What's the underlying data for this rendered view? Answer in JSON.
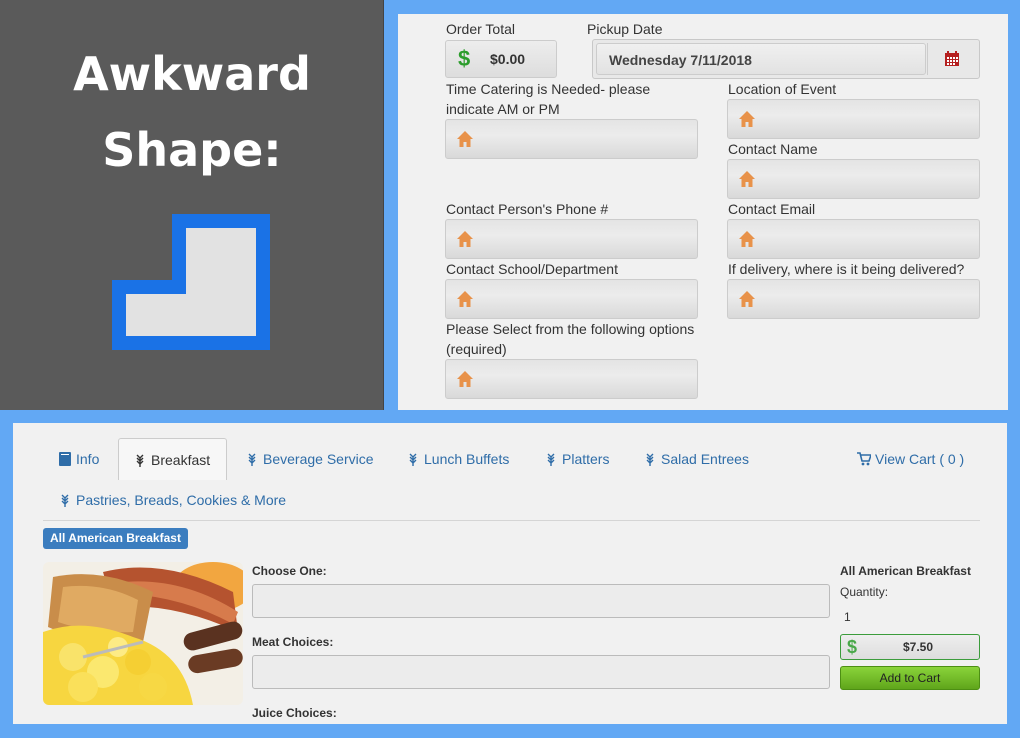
{
  "side": {
    "title_line1": "Awkward",
    "title_line2": "Shape:"
  },
  "order_form": {
    "order_total_label": "Order Total",
    "order_total_value": "$0.00",
    "pickup_date_label": "Pickup Date",
    "pickup_date_value": "Wednesday 7/11/2018",
    "time_label": "Time Catering is Needed- please indicate AM or PM",
    "location_label": "Location of Event",
    "contact_name_label": "Contact Name",
    "phone_label": "Contact Person's Phone #",
    "email_label": "Contact Email",
    "school_label": "Contact School/Department",
    "delivery_label": "If delivery, where is it being delivered?",
    "options_label": "Please Select from the following options (required)"
  },
  "tabs": {
    "info": "Info",
    "breakfast": "Breakfast",
    "beverage": "Beverage Service",
    "lunch": "Lunch Buffets",
    "platters": "Platters",
    "salad": "Salad Entrees",
    "cart": "View Cart ( 0 )",
    "pastries": "Pastries, Breads, Cookies & More"
  },
  "product": {
    "badge": "All American Breakfast",
    "choose_one_label": "Choose One:",
    "meat_label": "Meat Choices:",
    "juice_label": "Juice Choices:",
    "name": "All American Breakfast",
    "quantity_label": "Quantity:",
    "quantity_value": "1",
    "price": "$7.50",
    "add_to_cart": "Add to Cart"
  },
  "colors": {
    "accent": "#3b7dbf",
    "link": "#2f6da8",
    "home_icon": "#e8924a",
    "add_button": "#6cb52a",
    "background": "#62a8f4"
  },
  "icons": {
    "field": "home-icon",
    "calendar": "calendar-icon",
    "tab": "wheat-icon",
    "info": "book-icon",
    "cart": "cart-icon"
  }
}
